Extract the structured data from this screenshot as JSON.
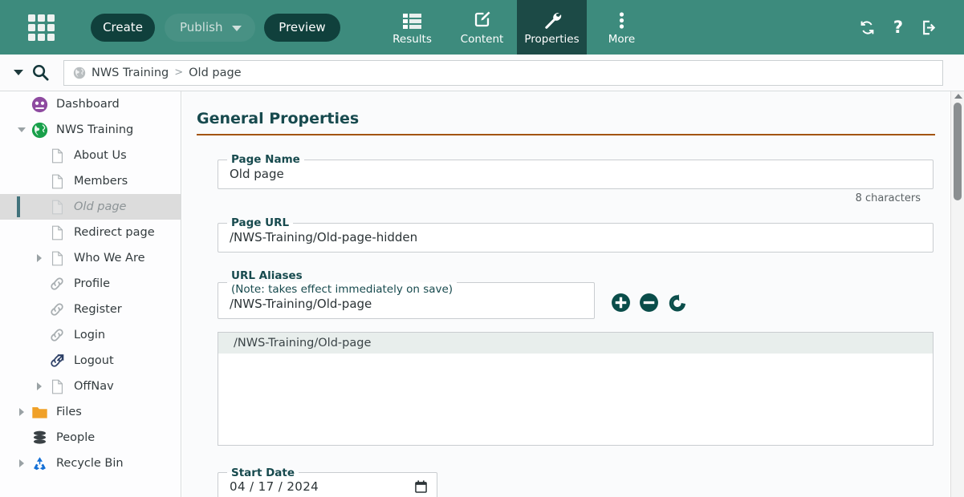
{
  "toolbar": {
    "apps_icon": "grid-apps-icon",
    "create_label": "Create",
    "publish_label": "Publish",
    "preview_label": "Preview",
    "tabs": [
      {
        "label": "Results",
        "icon": "list-icon",
        "active": false
      },
      {
        "label": "Content",
        "icon": "edit-square-icon",
        "active": false
      },
      {
        "label": "Properties",
        "icon": "wrench-icon",
        "active": true
      },
      {
        "label": "More",
        "icon": "vertical-dots-icon",
        "active": false
      }
    ],
    "refresh_icon": "refresh-icon",
    "help_label": "?",
    "logout_icon": "logout-icon",
    "bar_color": "#3d8b7d",
    "active_tab_color": "#1c4a46"
  },
  "breadcrumb": {
    "site_icon": "globe-icon",
    "root": "NWS Training",
    "separator": ">",
    "current": "Old page",
    "search_icon": "search-icon",
    "caret_icon": "chevron-down-icon"
  },
  "sidebar": {
    "items": [
      {
        "label": "Dashboard",
        "icon": "dashboard-icon",
        "indent": 1,
        "twisty": "none",
        "selected": false
      },
      {
        "label": "NWS Training",
        "icon": "globe-icon",
        "indent": 1,
        "twisty": "expanded",
        "selected": false
      },
      {
        "label": "About Us",
        "icon": "page-icon",
        "indent": 2,
        "twisty": "none",
        "selected": false
      },
      {
        "label": "Members",
        "icon": "page-icon",
        "indent": 2,
        "twisty": "none",
        "selected": false
      },
      {
        "label": "Old page",
        "icon": "page-icon",
        "indent": 2,
        "twisty": "none",
        "selected": true
      },
      {
        "label": "Redirect page",
        "icon": "page-icon",
        "indent": 2,
        "twisty": "none",
        "selected": false
      },
      {
        "label": "Who We Are",
        "icon": "page-icon",
        "indent": 2,
        "twisty": "collapsed",
        "selected": false
      },
      {
        "label": "Profile",
        "icon": "link-icon",
        "indent": 2,
        "twisty": "none",
        "selected": false
      },
      {
        "label": "Register",
        "icon": "link-icon",
        "indent": 2,
        "twisty": "none",
        "selected": false
      },
      {
        "label": "Login",
        "icon": "link-icon",
        "indent": 2,
        "twisty": "none",
        "selected": false
      },
      {
        "label": "Logout",
        "icon": "external-link-icon",
        "indent": 2,
        "twisty": "none",
        "selected": false
      },
      {
        "label": "OffNav",
        "icon": "page-icon",
        "indent": 2,
        "twisty": "collapsed",
        "selected": false
      },
      {
        "label": "Files",
        "icon": "folder-icon",
        "indent": 1,
        "twisty": "collapsed",
        "selected": false
      },
      {
        "label": "People",
        "icon": "people-db-icon",
        "indent": 1,
        "twisty": "none",
        "selected": false
      },
      {
        "label": "Recycle Bin",
        "icon": "recycle-icon",
        "indent": 1,
        "twisty": "collapsed",
        "selected": false
      }
    ],
    "selected_bar_color": "#42737c"
  },
  "main": {
    "heading": "General Properties",
    "rule_color": "#a3540f",
    "page_name": {
      "legend": "Page Name",
      "value": "Old page",
      "char_count": "8 characters"
    },
    "page_url": {
      "legend": "Page URL",
      "value": "/NWS-Training/Old-page-hidden"
    },
    "url_aliases": {
      "legend": "URL Aliases",
      "legend_note": "(Note: takes effect immediately on save)",
      "value": "/NWS-Training/Old-page",
      "add_icon": "plus-circle-icon",
      "remove_icon": "minus-circle-icon",
      "undo_icon": "undo-icon",
      "list": [
        "/NWS-Training/Old-page"
      ]
    },
    "start_date": {
      "legend": "Start Date",
      "value": "04 / 17 / 2024",
      "calendar_icon": "calendar-icon"
    }
  },
  "scrollbar": {
    "up_icon": "scroll-up-arrow-icon"
  }
}
